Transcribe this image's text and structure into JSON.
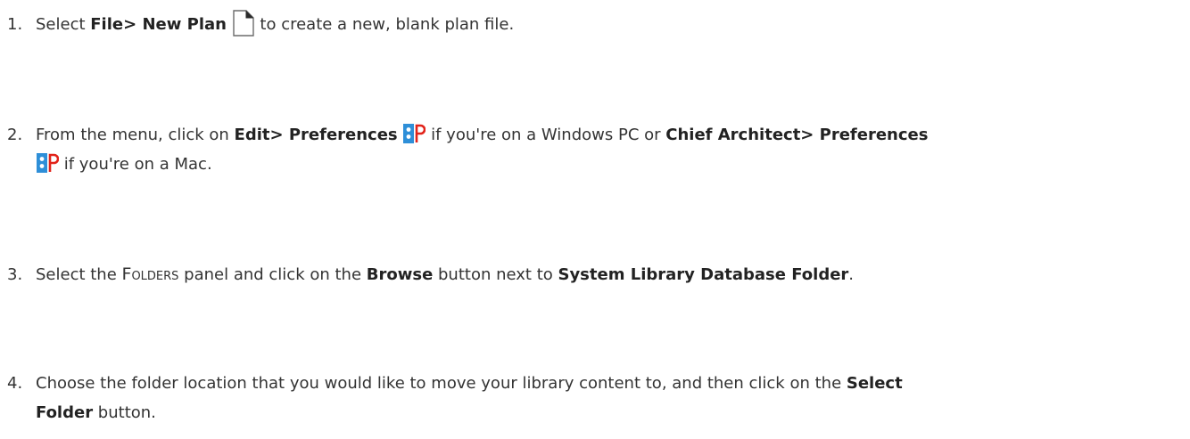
{
  "steps": [
    {
      "number": "1.",
      "a": "Select ",
      "b_menu": "File> New Plan",
      "icon": "new-plan-icon",
      "c": " to create a new, blank plan file."
    },
    {
      "number": "2.",
      "a": "From the menu, click on ",
      "b_menu": "Edit> Preferences",
      "icon": "preferences-icon",
      "c": " if you're on a Windows PC or ",
      "d_menu": "Chief Architect> Preferences",
      "e": " if you're on a Mac."
    },
    {
      "number": "3.",
      "a": "Select the ",
      "panel": "Folders",
      "b": " panel and click on the ",
      "button": "Browse",
      "c": " button next to ",
      "field": "System Library Database Folder",
      "d": "."
    },
    {
      "number": "4.",
      "a": "Choose the folder location that you would like to move your library content to, and then click on the ",
      "button_part1": "Select",
      "button_part2": "Folder",
      "b": " button."
    }
  ],
  "colors": {
    "text": "#333333",
    "pref_icon_blue": "#2e8fd8",
    "pref_icon_red": "#e2231a"
  }
}
